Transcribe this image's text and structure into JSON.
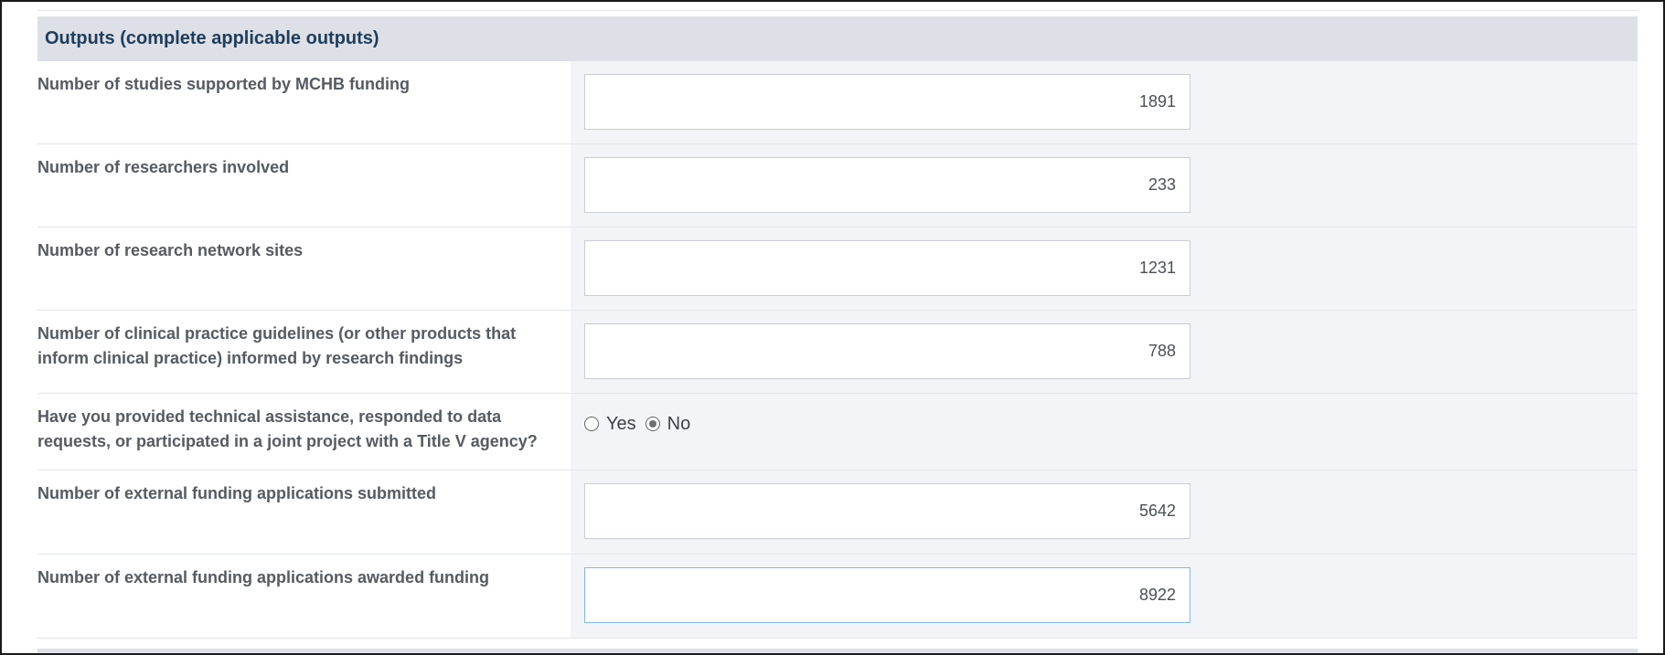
{
  "section": {
    "title": "Outputs (complete applicable outputs)"
  },
  "fields": [
    {
      "label": "Number of studies supported by MCHB funding",
      "value": "1891"
    },
    {
      "label": "Number of researchers involved",
      "value": "233"
    },
    {
      "label": "Number of research network sites",
      "value": "1231"
    },
    {
      "label": "Number of clinical practice guidelines (or other products that inform clinical practice) informed by research findings",
      "value": "788"
    }
  ],
  "question": {
    "label": "Have you provided technical assistance, responded to data requests, or participated in a joint project with a Title V agency?",
    "options": [
      "Yes",
      "No"
    ],
    "selected": "No"
  },
  "fields2": [
    {
      "label": "Number of external funding applications submitted",
      "value": "5642"
    },
    {
      "label": "Number of external funding applications awarded funding",
      "value": "8922"
    }
  ],
  "colors": {
    "header_bg": "#dde0e6",
    "header_text": "#1f3d5c",
    "input_column_bg": "#f3f4f7",
    "focus_border": "#7fb6ec"
  }
}
